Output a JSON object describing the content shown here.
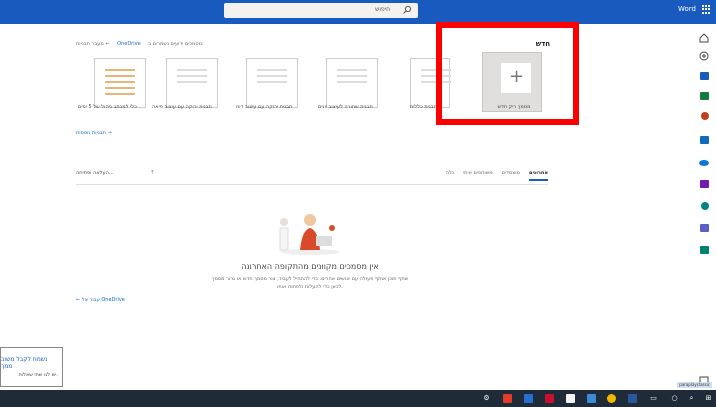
{
  "topbar": {
    "app_title": "Word",
    "search_placeholder": "חיפוש",
    "color": "#185abd"
  },
  "new_section": {
    "title": "חדש",
    "header_links": [
      "מסמכים ידועים נשמרים ב:",
      "OneDrive",
      "מעבר תבניות ←"
    ],
    "blank_label": "מסמך ריק חדש",
    "templates": [
      {
        "label": "תבנית כללית",
        "style": "plain"
      },
      {
        "label": "תבנית שחורה לעיצוב יונים",
        "style": "plain"
      },
      {
        "label": "תבנית ירוקה עם עיצוב דוח",
        "style": "plain"
      },
      {
        "label": "תבנית ירוקה עם עיצוב פיאה",
        "style": "plain"
      },
      {
        "label": "כלי למכתב ניהול של 5 ימים",
        "style": "resume"
      }
    ],
    "more_templates": "תבניות נוספות →"
  },
  "files": {
    "tabs": [
      "אחרונים",
      "מוצמדים",
      "משותפים איתי",
      "גלה"
    ],
    "active_tab": "אחרונים",
    "upload_label": "העלאה ופתיחה...",
    "empty_title": "אין מסמכים מקוונים מהתקופה האחרונה",
    "empty_sub1": "שתף תוכן ושתף פעולה עם אנשים אחרים. כדי להתחיל לעבוד, צור מסמך חדש או גרור מסמך",
    "empty_sub2": "לכאן כדי להעלות ולפתוח אותו.",
    "onedrive_link": "← עבור אל OneDrive"
  },
  "toast": {
    "line1": "נשמח לקבל משוב ממך",
    "line2": "יש לנו שתי שאלות."
  },
  "tooltip_text": "paraplayclassic",
  "rail_icons": [
    "home-icon",
    "new-icon",
    "word-icon",
    "excel-icon",
    "powerpoint-icon",
    "outlook-icon",
    "onedrive-icon",
    "onenote-icon",
    "sharepoint-icon",
    "teams-icon",
    "sway-icon"
  ],
  "taskbar_icons": [
    "settings-icon",
    "acrobat-icon",
    "app-icon",
    "app-icon",
    "store-icon",
    "mail-icon",
    "chrome-icon",
    "word-icon",
    "taskview-icon",
    "cortana-icon",
    "search-icon",
    "start-icon"
  ]
}
